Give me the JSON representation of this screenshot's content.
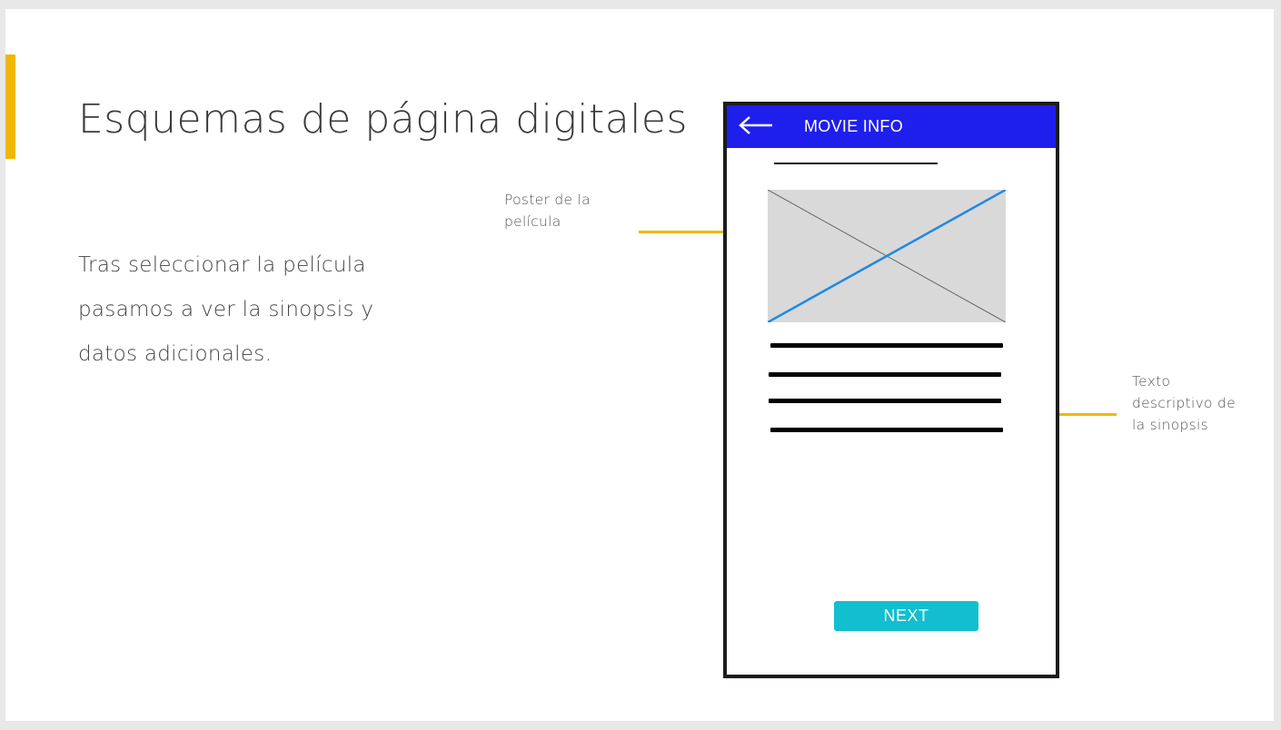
{
  "slide": {
    "title": "Esquemas de página digitales",
    "body_lines": [
      "Tras seleccionar la película",
      "pasamos a ver la sinopsis y",
      "datos adicionales."
    ]
  },
  "annotations": {
    "poster": [
      "Poster de la",
      "película"
    ],
    "synopsis": [
      "Texto",
      "descriptivo de",
      "la sinopsis"
    ]
  },
  "wireframe": {
    "app_bar_title": "MOVIE INFO",
    "back_icon": "arrow-left-icon",
    "poster_placeholder_icon": "image-placeholder-icon",
    "next_button_label": "NEXT"
  },
  "colors": {
    "accent": "#f2b705",
    "app_bar": "#1f1fed",
    "next_button": "#12bfcf",
    "placeholder": "#d9d9d9",
    "placeholder_diagonal": "#1e88e5"
  }
}
